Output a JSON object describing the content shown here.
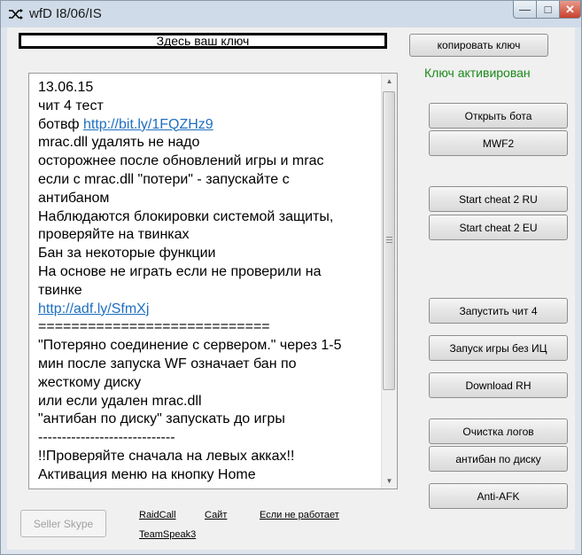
{
  "window": {
    "title": "wfD I8/06/IS",
    "icon": "shuffle-icon",
    "min_glyph": "—",
    "max_glyph": "□",
    "close_glyph": "✕"
  },
  "key": {
    "label": "Здесь ваш ключ",
    "copy_button": "копировать ключ",
    "status": "Ключ активирован"
  },
  "notes": {
    "lines": [
      {
        "text": "13.06.15"
      },
      {
        "text": "чит 4 тест"
      },
      {
        "text": "ботвф ",
        "link": "http://bit.ly/1FQZHz9"
      },
      {
        "text": "mrac.dll удалять не надо"
      },
      {
        "text": "осторожнее после обновлений игры и mrac"
      },
      {
        "text": "если с mrac.dll \"потери\" - запускайте с"
      },
      {
        "text": "антибаном"
      },
      {
        "text": "Наблюдаются блокировки системой защиты,"
      },
      {
        "text": "проверяйте на твинках"
      },
      {
        "text": "Бан за некоторые функции"
      },
      {
        "text": "На основе не играть если не проверили на"
      },
      {
        "text": "твинке"
      },
      {
        "text": "",
        "link": "http://adf.ly/SfmXj"
      },
      {
        "text": "============================"
      },
      {
        "text": "\"Потеряно соединение с сервером.\" через 1-5"
      },
      {
        "text": "мин после запуска WF означает бан по"
      },
      {
        "text": "жесткому диску"
      },
      {
        "text": "или если удален mrac.dll"
      },
      {
        "text": "\"антибан по диску\" запускать до игры"
      },
      {
        "text": "-----------------------------"
      },
      {
        "text": "!!Проверяйте сначала на левых акках!!"
      },
      {
        "text": "Активация меню на кнопку Home"
      }
    ]
  },
  "buttons": {
    "open_bot": "Открыть бота",
    "mwf2": "MWF2",
    "start_ru": "Start cheat 2 RU",
    "start_eu": "Start cheat 2 EU",
    "run_cheat4": "Запустить чит 4",
    "launch_no_ic": "Запуск игры без ИЦ",
    "download_rh": "Download RH",
    "clear_logs": "Очистка логов",
    "antiban_disk": "антибан по диску",
    "anti_afk": "Anti-AFK",
    "seller_skype": "Seller Skype"
  },
  "links": {
    "raidcall": "RaidCall",
    "site": "Сайт",
    "not_working": "Если не работает",
    "teamspeak": "TeamSpeak3"
  }
}
